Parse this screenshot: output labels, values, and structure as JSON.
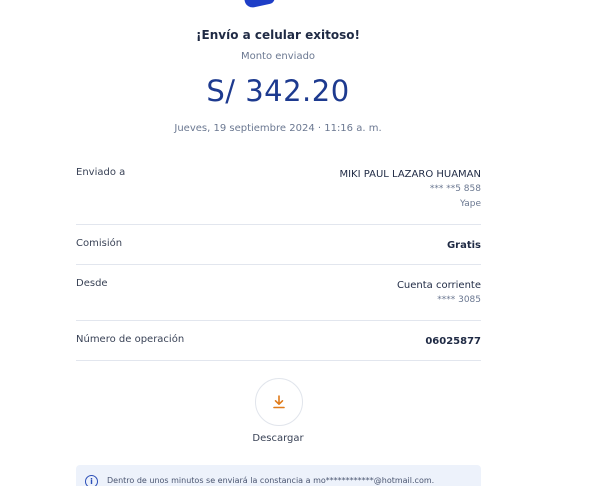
{
  "header": {
    "title": "¡Envío a celular exitoso!",
    "amount_label": "Monto enviado",
    "amount": "S/ 342.20",
    "datetime": "Jueves, 19 septiembre 2024 · 11:16 a. m."
  },
  "details": {
    "sent_to": {
      "label": "Enviado a",
      "name": "MIKI PAUL LAZARO HUAMAN",
      "phone": "*** **5 858",
      "app": "Yape"
    },
    "fee": {
      "label": "Comisión",
      "value": "Gratis"
    },
    "from": {
      "label": "Desde",
      "account": "Cuenta corriente",
      "account_number": "**** 3085"
    },
    "operation": {
      "label": "Número de operación",
      "value": "06025877"
    }
  },
  "download": {
    "label": "Descargar",
    "icon": "download-icon",
    "icon_color": "#e07b1a"
  },
  "info": {
    "icon": "info-icon",
    "text": "Dentro de unos minutos se enviará la constancia a mo************@hotmail.com."
  },
  "colors": {
    "brand_blue": "#1e3ec7",
    "amount_blue": "#1d3a8f",
    "accent_orange": "#e07b1a",
    "banner_bg": "#edf2fb"
  }
}
